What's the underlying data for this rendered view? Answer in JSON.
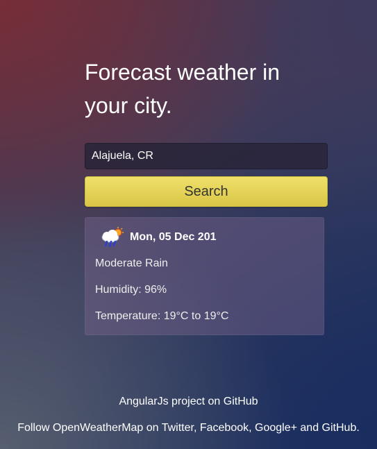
{
  "header": {
    "title": "Forecast weather in your city."
  },
  "search": {
    "value": "Alajuela, CR",
    "placeholder": "",
    "button_label": "Search"
  },
  "forecast": {
    "icon": "rain-sun-cloud-icon",
    "date": "Mon, 05 Dec 201",
    "description": "Moderate Rain",
    "humidity": "Humidity: 96%",
    "temperature": "Temperature: 19°C to 19°C"
  },
  "footer": {
    "project_link": "AngularJs project on GitHub",
    "follow_prefix": "Follow ",
    "follow_links": [
      "OpenWeatherMap",
      "Twitter",
      "Facebook",
      "Google+",
      "GitHub"
    ],
    "sep_on": " on ",
    "sep_comma": ", ",
    "sep_and": " and ",
    "follow_suffix": "."
  },
  "colors": {
    "button": "#e3d153",
    "card": "#6a5a80",
    "input": "#2a2538"
  }
}
